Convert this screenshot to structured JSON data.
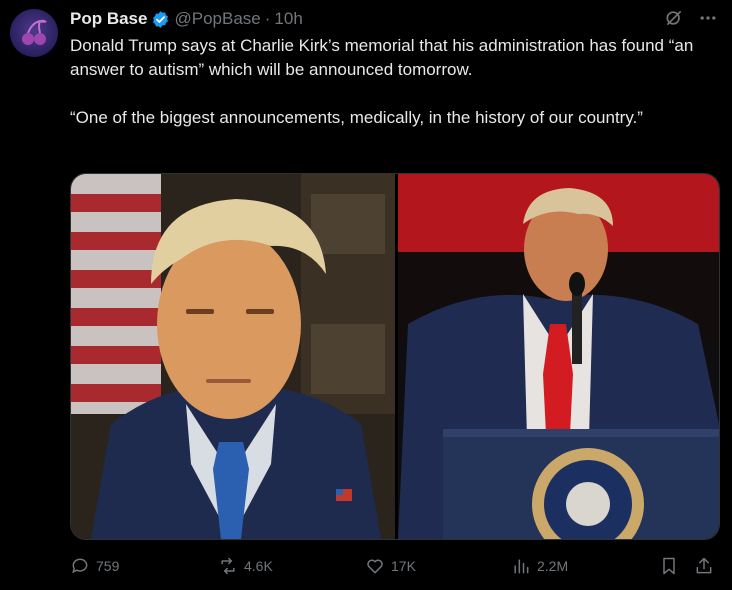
{
  "tweet": {
    "author_name": "Pop Base",
    "handle": "@PopBase",
    "separator": "·",
    "time": "10h",
    "text_line1": "Donald Trump says at Charlie Kirk’s memorial that his administration has found “an answer to autism” which will be announced tomorrow.",
    "text_line2": "“One of the biggest announcements, medically, in the history of our country.”"
  },
  "metrics": {
    "replies": "759",
    "reposts": "4.6K",
    "likes": "17K",
    "views": "2.2M"
  },
  "icons": {
    "avatar": "pop-base-avatar",
    "verified": "verified-badge-icon",
    "grok": "grok-icon",
    "more": "more-icon",
    "reply": "reply-icon",
    "repost": "repost-icon",
    "like": "like-icon",
    "views": "views-icon",
    "bookmark": "bookmark-icon",
    "share": "share-icon"
  },
  "colors": {
    "background": "#000000",
    "text": "#e7e9ea",
    "muted": "#71767b",
    "verified": "#1d9bf0"
  }
}
